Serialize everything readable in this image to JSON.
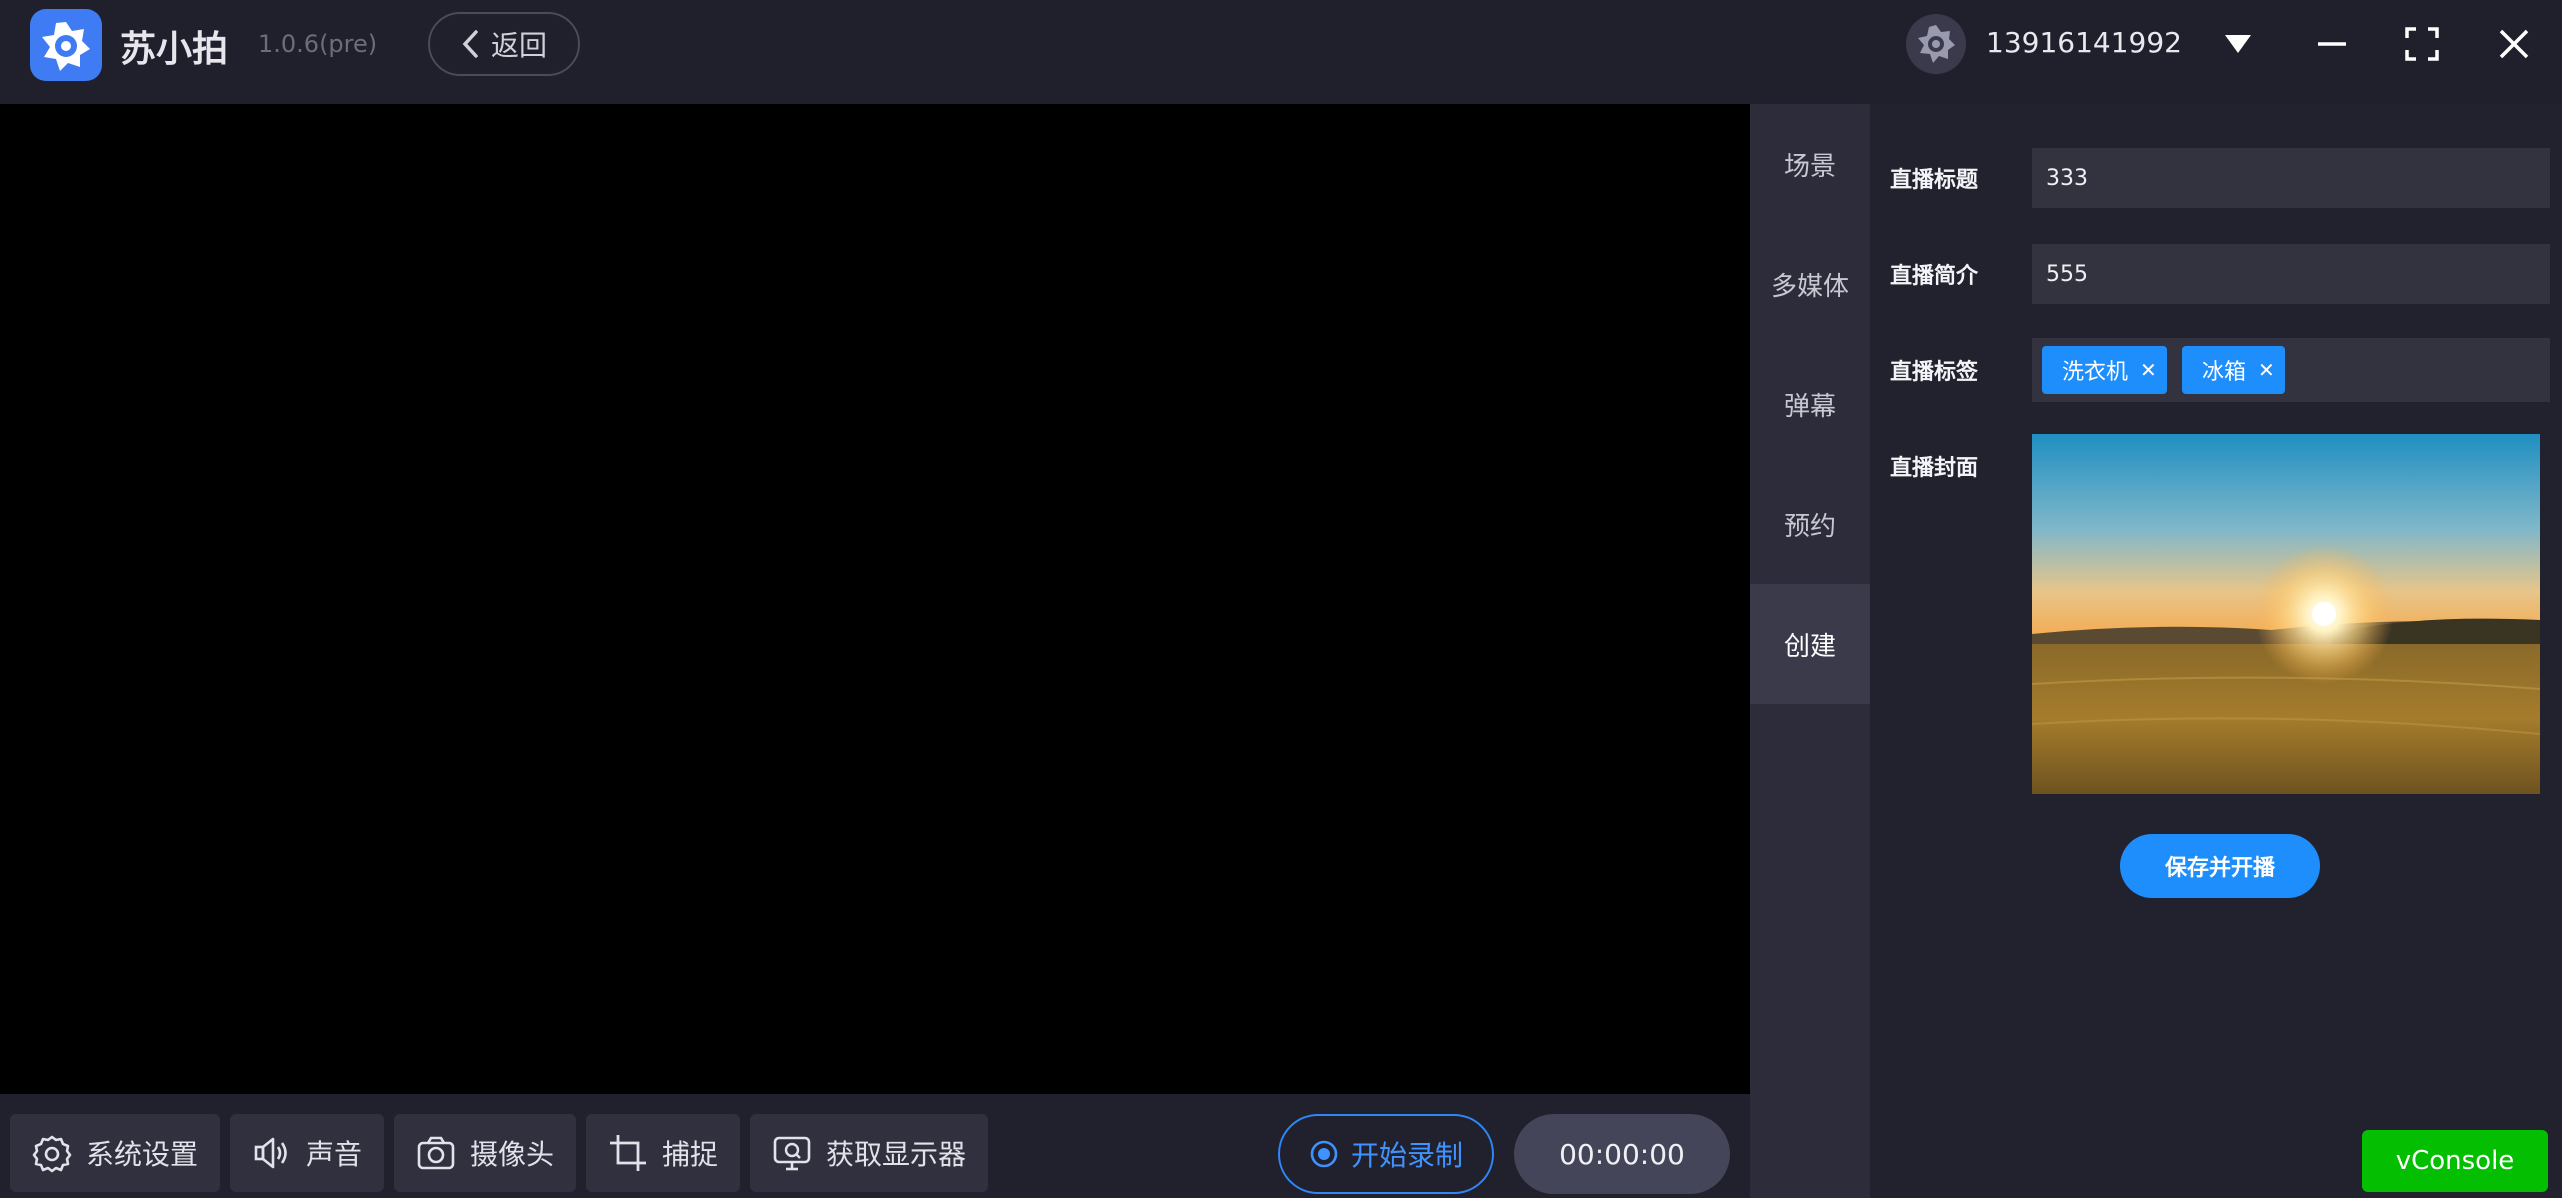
{
  "titlebar": {
    "app_name": "苏小拍",
    "version": "1.0.6(pre)",
    "back_label": "返回",
    "account": "13916141992"
  },
  "toolbar": {
    "settings_label": "系统设置",
    "sound_label": "声音",
    "camera_label": "摄像头",
    "capture_label": "捕捉",
    "display_label": "获取显示器",
    "record_label": "开始录制",
    "timer": "00:00:00"
  },
  "sidetabs": [
    {
      "label": "场景"
    },
    {
      "label": "多媒体"
    },
    {
      "label": "弹幕"
    },
    {
      "label": "预约"
    },
    {
      "label": "创建",
      "active": true
    }
  ],
  "form": {
    "title_label": "直播标题",
    "title_value": "333",
    "intro_label": "直播简介",
    "intro_value": "555",
    "tags_label": "直播标签",
    "tags": [
      "洗衣机",
      "冰箱"
    ],
    "cover_label": "直播封面",
    "save_label": "保存并开播"
  },
  "vconsole": {
    "label": "vConsole"
  },
  "colors": {
    "accent": "#1e8efc",
    "background": "#22222e",
    "preview": "#000000",
    "vconsole": "#04be02"
  }
}
